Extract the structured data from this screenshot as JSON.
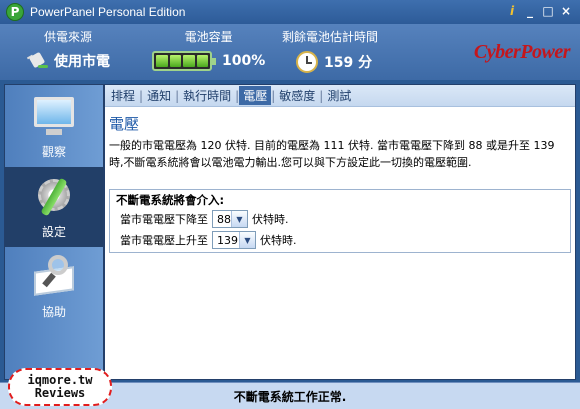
{
  "window": {
    "title": "PowerPanel Personal Edition",
    "controls": [
      "i",
      "_",
      "□",
      "×"
    ]
  },
  "header": {
    "power_source_label": "供電來源",
    "power_source_value": "使用市電",
    "battery_label": "電池容量",
    "battery_value": "100%",
    "battery_level": 1.0,
    "runtime_label": "剩餘電池估計時間",
    "runtime_value": "159 分",
    "brand": "CyberPower",
    "brand_color": "#c4161c"
  },
  "sidebar": {
    "items": [
      {
        "label": "觀察",
        "icon": "monitor-icon"
      },
      {
        "label": "設定",
        "icon": "settings-icon"
      },
      {
        "label": "協助",
        "icon": "help-icon"
      }
    ],
    "active_index": 1
  },
  "tabs": {
    "items": [
      "排程",
      "通知",
      "執行時間",
      "電壓",
      "敏感度",
      "測試"
    ],
    "active_index": 3
  },
  "main": {
    "title": "電壓",
    "description": "一般的市電電壓為 120 伏特. 目前的電壓為 111 伏特. 當市電電壓下降到 88 或是升至 139 時,不斷電系統將會以電池電力輸出.您可以與下方設定此一切換的電壓範圍.",
    "box_title": "不斷電系統將會介入:",
    "low_prefix": "當市電電壓下降至",
    "low_value": "88",
    "low_suffix": "伏特時.",
    "high_prefix": "當市電電壓上升至",
    "high_value": "139",
    "high_suffix": "伏特時."
  },
  "status": {
    "text": "不斷電系統工作正常."
  },
  "watermark": {
    "line1": "iqmore.tw",
    "line2": "Reviews"
  }
}
